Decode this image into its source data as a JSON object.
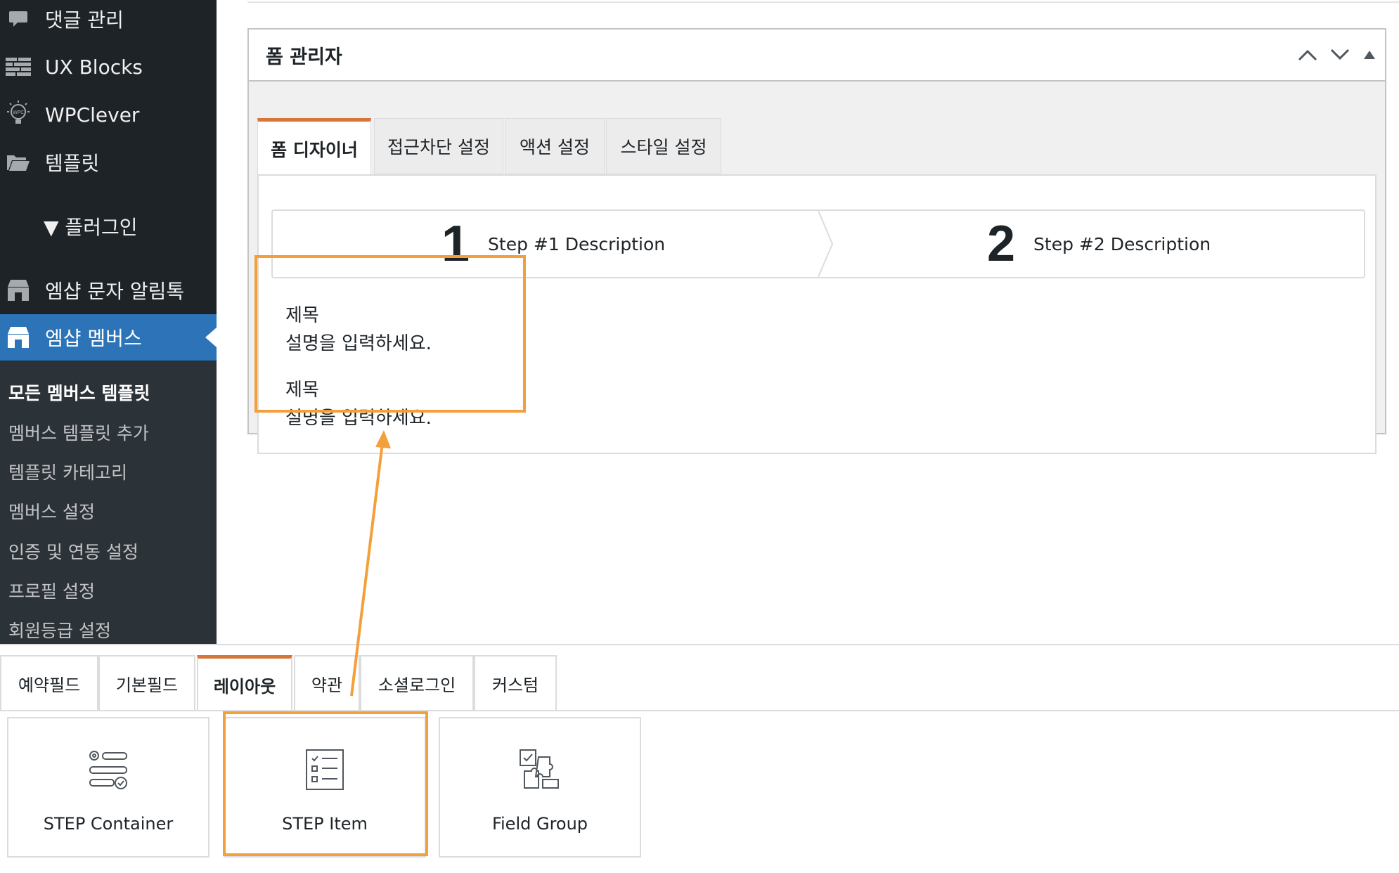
{
  "sidebar": {
    "items": [
      {
        "label": "댓글 관리",
        "icon": "comment-icon"
      },
      {
        "label": "UX Blocks",
        "icon": "blocks-icon"
      },
      {
        "label": "WPClever",
        "icon": "lightbulb-icon"
      },
      {
        "label": "템플릿",
        "icon": "folder-icon"
      },
      {
        "label": "▼ 플러그인",
        "icon": ""
      },
      {
        "label": "엠샵 문자 알림톡",
        "icon": "shop-icon"
      },
      {
        "label": "엠샵 멤버스",
        "icon": "shop-icon"
      }
    ],
    "submenu": [
      {
        "label": "모든 멤버스 템플릿"
      },
      {
        "label": "멤버스 템플릿 추가"
      },
      {
        "label": "템플릿 카테고리"
      },
      {
        "label": "멤버스 설정"
      },
      {
        "label": "인증 및 연동 설정"
      },
      {
        "label": "프로필 설정"
      },
      {
        "label": "회원등급 설정"
      }
    ]
  },
  "postbox": {
    "title": "폼 관리자",
    "tabs": [
      {
        "label": "폼 디자이너"
      },
      {
        "label": "접근차단 설정"
      },
      {
        "label": "액션 설정"
      },
      {
        "label": "스타일 설정"
      }
    ],
    "steps": [
      {
        "number": "1",
        "description": "Step #1 Description"
      },
      {
        "number": "2",
        "description": "Step #2 Description"
      }
    ],
    "step_item": {
      "title1": "제목",
      "desc1": "설명을 입력하세요.",
      "title2": "제목",
      "desc2": "설명을 입력하세요."
    }
  },
  "library": {
    "tabs": [
      {
        "label": "예약필드"
      },
      {
        "label": "기본필드"
      },
      {
        "label": "레이아웃"
      },
      {
        "label": "약관"
      },
      {
        "label": "소셜로그인"
      },
      {
        "label": "커스텀"
      }
    ],
    "cards": [
      {
        "label": "STEP Container",
        "icon": "step-container-icon"
      },
      {
        "label": "STEP Item",
        "icon": "step-item-icon"
      },
      {
        "label": "Field Group",
        "icon": "field-group-icon"
      }
    ]
  },
  "colors": {
    "accent": "#d6763a",
    "highlight": "#f3a03c",
    "sidebar_bg": "#1d2327",
    "sidebar_active": "#2d73b8"
  }
}
